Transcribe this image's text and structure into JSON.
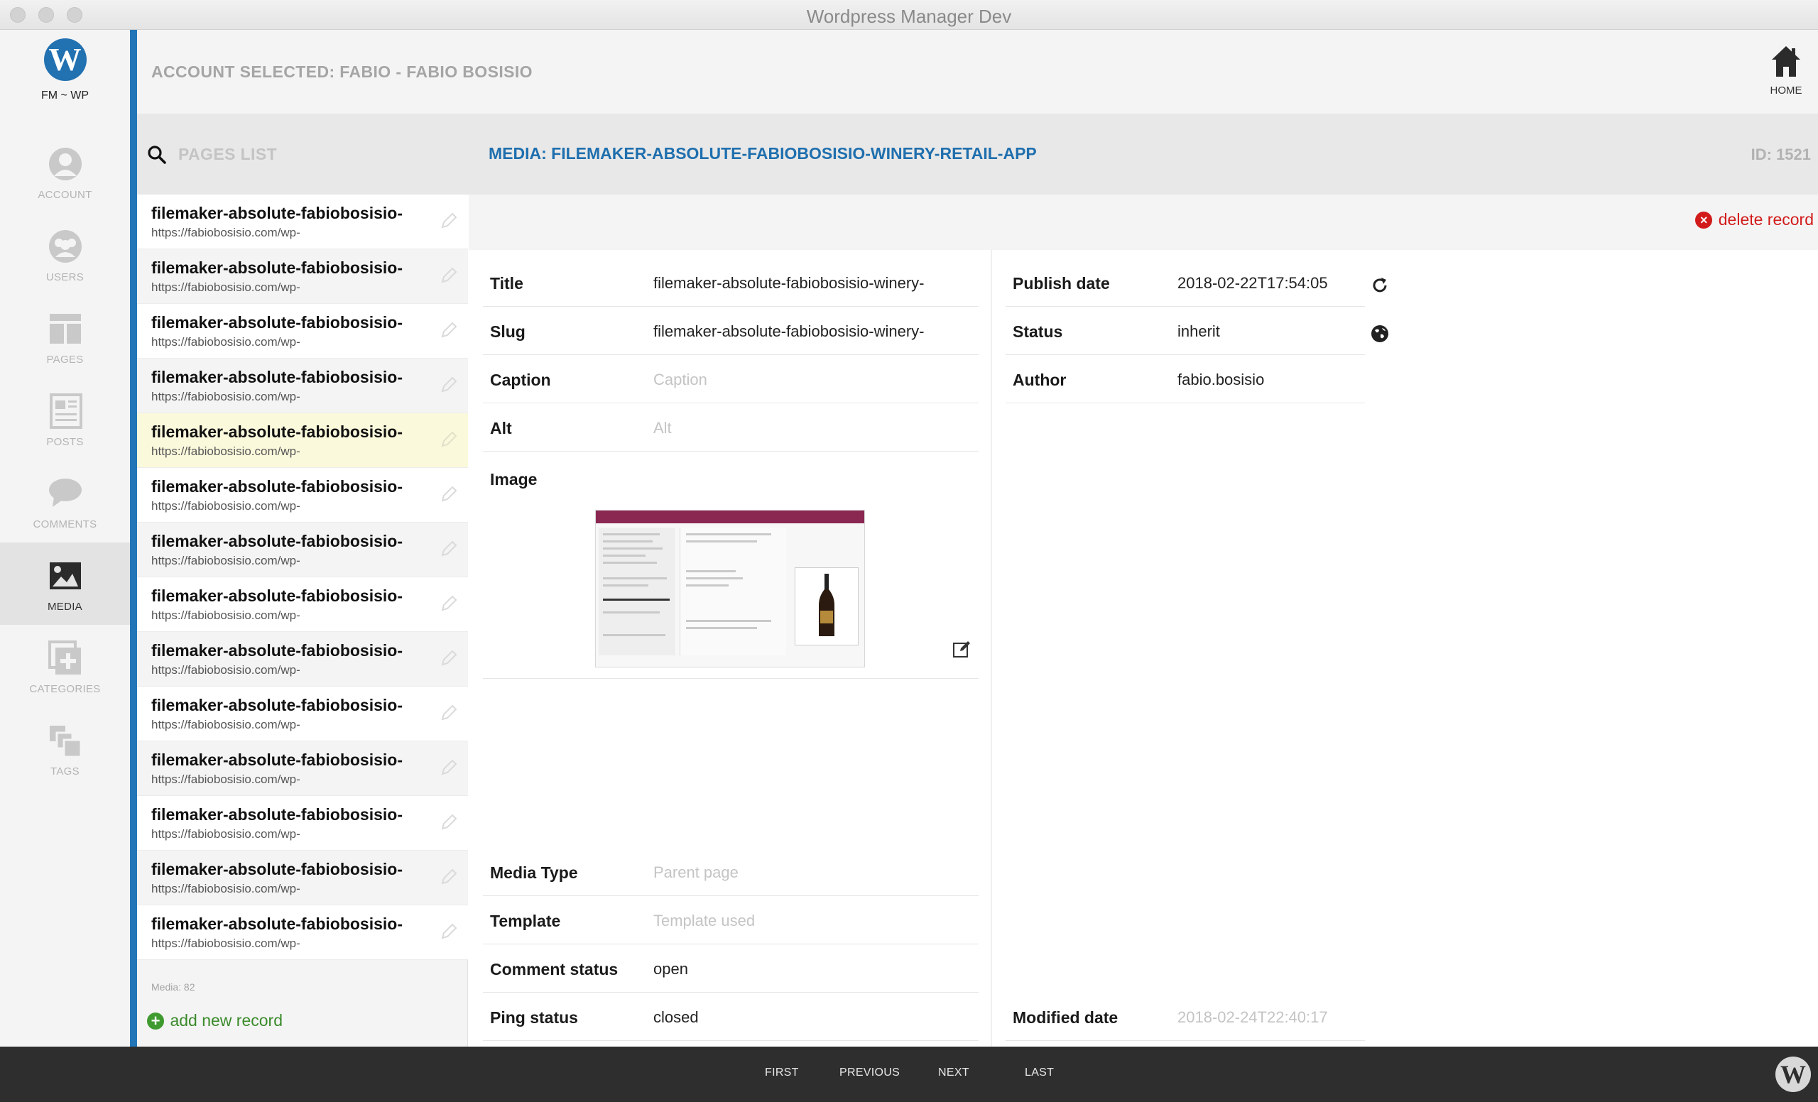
{
  "window": {
    "title": "Wordpress Manager Dev"
  },
  "nav": {
    "logo_label": "FM ~ WP",
    "items": [
      {
        "label": "ACCOUNT",
        "icon": "user-icon"
      },
      {
        "label": "USERS",
        "icon": "users-icon"
      },
      {
        "label": "PAGES",
        "icon": "pages-icon"
      },
      {
        "label": "POSTS",
        "icon": "posts-icon"
      },
      {
        "label": "COMMENTS",
        "icon": "comments-icon"
      },
      {
        "label": "MEDIA",
        "icon": "image-icon",
        "active": true
      },
      {
        "label": "CATEGORIES",
        "icon": "categories-icon"
      },
      {
        "label": "TAGS",
        "icon": "tags-icon"
      }
    ]
  },
  "header": {
    "account_selected": "ACCOUNT SELECTED: FABIO - FABIO BOSISIO",
    "home_label": "HOME"
  },
  "subheader": {
    "search_label": "PAGES LIST",
    "media_title": "MEDIA: FILEMAKER-ABSOLUTE-FABIOBOSISIO-WINERY-RETAIL-APP",
    "record_id": "ID: 1521"
  },
  "list": {
    "items": [
      {
        "title": "filemaker-absolute-fabiobosisio-",
        "url": "https://fabiobosisio.com/wp-"
      },
      {
        "title": "filemaker-absolute-fabiobosisio-",
        "url": "https://fabiobosisio.com/wp-"
      },
      {
        "title": "filemaker-absolute-fabiobosisio-",
        "url": "https://fabiobosisio.com/wp-"
      },
      {
        "title": "filemaker-absolute-fabiobosisio-",
        "url": "https://fabiobosisio.com/wp-"
      },
      {
        "title": "filemaker-absolute-fabiobosisio-",
        "url": "https://fabiobosisio.com/wp-",
        "selected": true
      },
      {
        "title": "filemaker-absolute-fabiobosisio-",
        "url": "https://fabiobosisio.com/wp-"
      },
      {
        "title": "filemaker-absolute-fabiobosisio-",
        "url": "https://fabiobosisio.com/wp-"
      },
      {
        "title": "filemaker-absolute-fabiobosisio-",
        "url": "https://fabiobosisio.com/wp-"
      },
      {
        "title": "filemaker-absolute-fabiobosisio-",
        "url": "https://fabiobosisio.com/wp-"
      },
      {
        "title": "filemaker-absolute-fabiobosisio-",
        "url": "https://fabiobosisio.com/wp-"
      },
      {
        "title": "filemaker-absolute-fabiobosisio-",
        "url": "https://fabiobosisio.com/wp-"
      },
      {
        "title": "filemaker-absolute-fabiobosisio-",
        "url": "https://fabiobosisio.com/wp-"
      },
      {
        "title": "filemaker-absolute-fabiobosisio-",
        "url": "https://fabiobosisio.com/wp-"
      },
      {
        "title": "filemaker-absolute-fabiobosisio-",
        "url": "https://fabiobosisio.com/wp-"
      }
    ],
    "count_label": "Media: 82",
    "add_label": "add new record"
  },
  "detail": {
    "delete_label": "delete record",
    "left": {
      "title_label": "Title",
      "title_value": "filemaker-absolute-fabiobosisio-winery-",
      "slug_label": "Slug",
      "slug_value": "filemaker-absolute-fabiobosisio-winery-",
      "caption_label": "Caption",
      "caption_placeholder": "Caption",
      "alt_label": "Alt",
      "alt_placeholder": "Alt",
      "image_label": "Image",
      "media_type_label": "Media Type",
      "media_type_placeholder": "Parent page",
      "template_label": "Template",
      "template_placeholder": "Template used",
      "comment_status_label": "Comment status",
      "comment_status_value": "open",
      "ping_status_label": "Ping status",
      "ping_status_value": "closed"
    },
    "right": {
      "publish_label": "Publish date",
      "publish_value": "2018-02-22T17:54:05",
      "status_label": "Status",
      "status_value": "inherit",
      "author_label": "Author",
      "author_value": "fabio.bosisio",
      "modified_label": "Modified date",
      "modified_value": "2018-02-24T22:40:17"
    }
  },
  "pager": {
    "first": "FIRST",
    "previous": "PREVIOUS",
    "next": "NEXT",
    "last": "LAST"
  },
  "colors": {
    "accent": "#2276b8",
    "title_blue": "#1f6fae",
    "delete_red": "#d21b1b",
    "add_green": "#3f9a2f",
    "selected_row": "#fbf9dc"
  }
}
